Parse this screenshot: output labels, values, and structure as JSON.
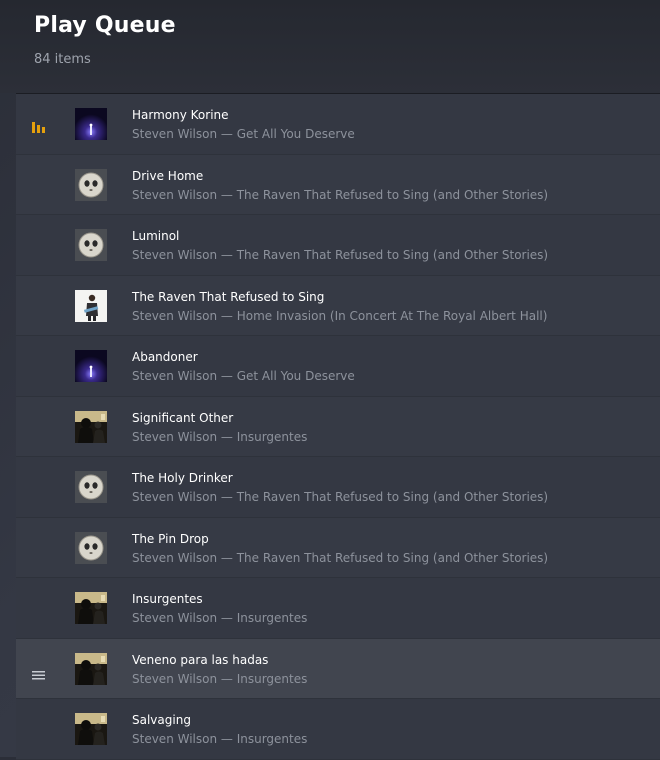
{
  "header": {
    "title": "Play Queue",
    "count": "84 items"
  },
  "colors": {
    "playing_accent": "#e5a00d",
    "subtitle": "#8d929c"
  },
  "queue": [
    {
      "title": "Harmony Korine",
      "artist": "Steven Wilson",
      "album": "Get All You Deserve",
      "subtitle": "Steven Wilson — Get All You Deserve",
      "art": "get-all-you-deserve",
      "state": "playing",
      "icon": "now-playing-bars-icon"
    },
    {
      "title": "Drive Home",
      "artist": "Steven Wilson",
      "album": "The Raven That Refused to Sing (and Other Stories)",
      "subtitle": "Steven Wilson — The Raven That Refused to Sing (and Other Stories)",
      "art": "raven"
    },
    {
      "title": "Luminol",
      "artist": "Steven Wilson",
      "album": "The Raven That Refused to Sing (and Other Stories)",
      "subtitle": "Steven Wilson — The Raven That Refused to Sing (and Other Stories)",
      "art": "raven"
    },
    {
      "title": "The Raven That Refused to Sing",
      "artist": "Steven Wilson",
      "album": "Home Invasion (In Concert At The Royal Albert Hall)",
      "subtitle": "Steven Wilson — Home Invasion (In Concert At The Royal Albert Hall)",
      "art": "home-invasion"
    },
    {
      "title": "Abandoner",
      "artist": "Steven Wilson",
      "album": "Get All You Deserve",
      "subtitle": "Steven Wilson — Get All You Deserve",
      "art": "get-all-you-deserve"
    },
    {
      "title": "Significant Other",
      "artist": "Steven Wilson",
      "album": "Insurgentes",
      "subtitle": "Steven Wilson — Insurgentes",
      "art": "insurgentes"
    },
    {
      "title": "The Holy Drinker",
      "artist": "Steven Wilson",
      "album": "The Raven That Refused to Sing (and Other Stories)",
      "subtitle": "Steven Wilson — The Raven That Refused to Sing (and Other Stories)",
      "art": "raven"
    },
    {
      "title": "The Pin Drop",
      "artist": "Steven Wilson",
      "album": "The Raven That Refused to Sing (and Other Stories)",
      "subtitle": "Steven Wilson — The Raven That Refused to Sing (and Other Stories)",
      "art": "raven"
    },
    {
      "title": "Insurgentes",
      "artist": "Steven Wilson",
      "album": "Insurgentes",
      "subtitle": "Steven Wilson — Insurgentes",
      "art": "insurgentes"
    },
    {
      "title": "Veneno para las hadas",
      "artist": "Steven Wilson",
      "album": "Insurgentes",
      "subtitle": "Steven Wilson — Insurgentes",
      "art": "insurgentes",
      "state": "hover",
      "icon": "drag-handle-icon"
    },
    {
      "title": "Salvaging",
      "artist": "Steven Wilson",
      "album": "Insurgentes",
      "subtitle": "Steven Wilson — Insurgentes",
      "art": "insurgentes"
    }
  ]
}
